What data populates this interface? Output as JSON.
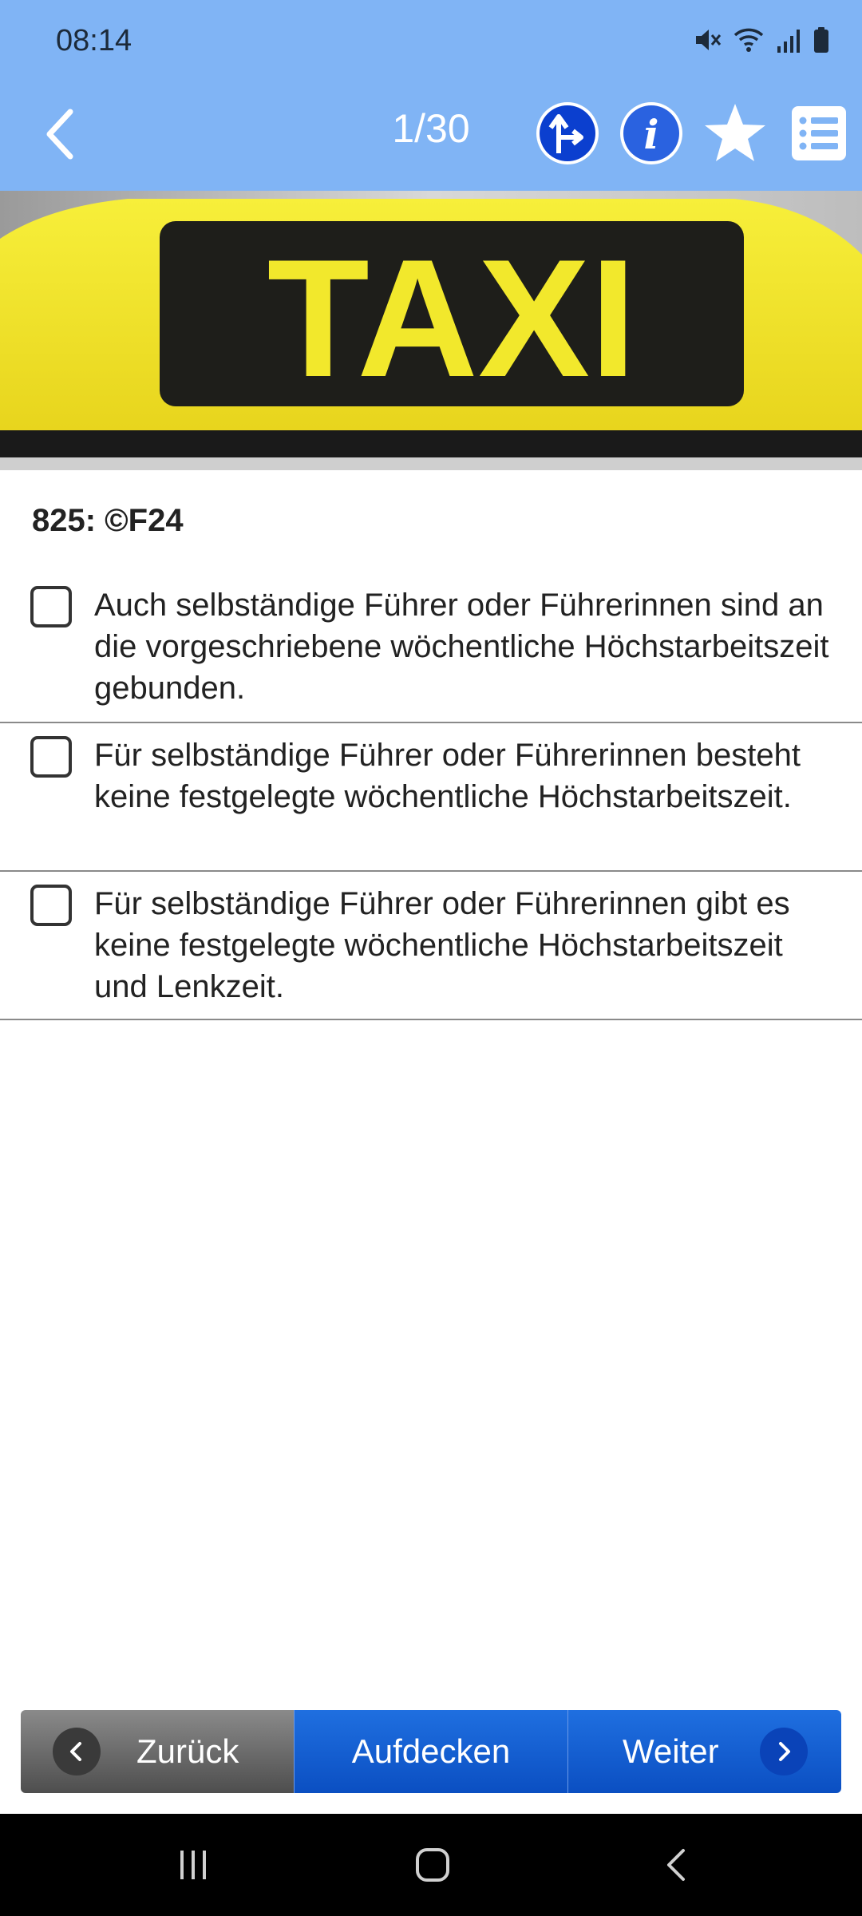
{
  "status_bar": {
    "time": "08:14",
    "icons": [
      "mute-icon",
      "wifi-icon",
      "signal-icon",
      "battery-icon"
    ]
  },
  "header": {
    "back_icon": "chevron-left-icon",
    "counter": "1/30",
    "icons": [
      "direction-sign-icon",
      "info-icon",
      "star-icon",
      "list-icon"
    ]
  },
  "image": {
    "sign_text": "TAXI"
  },
  "question": {
    "id_label": "825:  ©F24",
    "answers": [
      {
        "text": "Auch selbständige Führer oder Führerinnen sind an die vorgeschriebene wöchentliche Höchstarbeitszeit gebunden.",
        "checked": false
      },
      {
        "text": "Für selbständige Führer oder Führerinnen besteht keine festgelegte wöchentliche Höchstarbeitszeit.",
        "checked": false
      },
      {
        "text": "Für selbständige Führer oder Führerinnen gibt es keine festgelegte wöchentliche Höchstarbeitszeit und Lenkzeit.",
        "checked": false
      }
    ]
  },
  "footer": {
    "back_label": "Zurück",
    "reveal_label": "Aufdecken",
    "next_label": "Weiter"
  },
  "colors": {
    "header_bg": "#80b4f5",
    "button_blue": "#1560d8",
    "button_gray": "#6e6e6e"
  }
}
